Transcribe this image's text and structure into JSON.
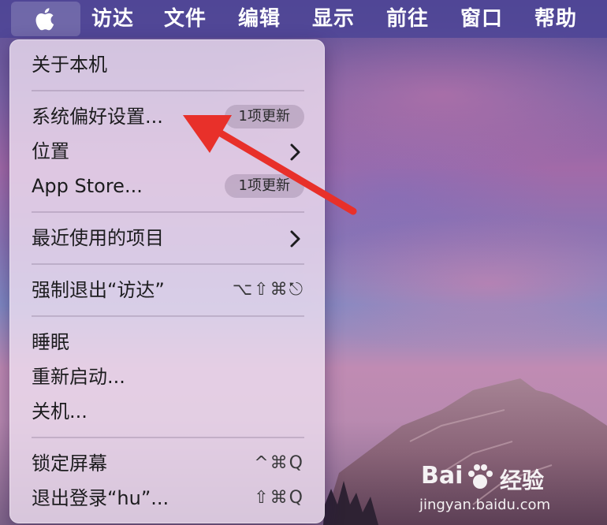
{
  "menubar": {
    "apple_icon": "apple-logo-icon",
    "items": [
      "访达",
      "文件",
      "编辑",
      "显示",
      "前往",
      "窗口",
      "帮助"
    ]
  },
  "menu": {
    "about": "关于本机",
    "system_prefs": "系统偏好设置...",
    "system_prefs_badge": "1项更新",
    "location": "位置",
    "app_store": "App Store...",
    "app_store_badge": "1项更新",
    "recent_items": "最近使用的项目",
    "force_quit": "强制退出“访达”",
    "force_quit_shortcut": "⌥⇧⌘⎋",
    "sleep": "睡眠",
    "restart": "重新启动...",
    "shutdown": "关机...",
    "lock_screen": "锁定屏幕",
    "lock_screen_shortcut": "^⌘Q",
    "logout": "退出登录“hu”...",
    "logout_shortcut": "⇧⌘Q"
  },
  "annotation": {
    "arrow_color": "#e8302a"
  },
  "watermark": {
    "brand": "Bai",
    "brand2": "经验",
    "url": "jingyan.baidu.com"
  },
  "colors": {
    "menubar": "#4e4696",
    "menu_bg": "#eedef0"
  }
}
